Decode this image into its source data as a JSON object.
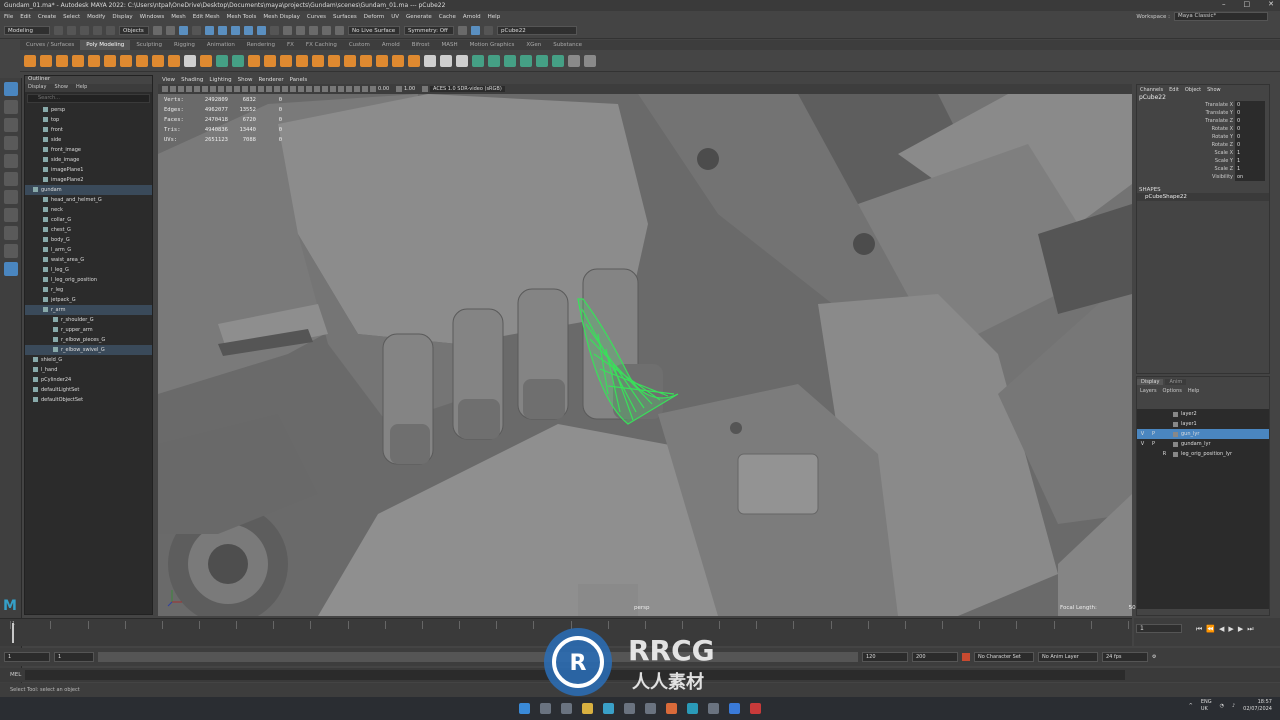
{
  "window": {
    "title": "Gundam_01.ma* - Autodesk MAYA 2022: C:\\Users\\ntpal\\OneDrive\\Desktop\\Documents\\maya\\projects\\Gundam\\scenes\\Gundam_01.ma  ---  pCube22"
  },
  "menubar": {
    "items": [
      "File",
      "Edit",
      "Create",
      "Select",
      "Modify",
      "Display",
      "Windows",
      "Mesh",
      "Edit Mesh",
      "Mesh Tools",
      "Mesh Display",
      "Curves",
      "Surfaces",
      "Deform",
      "UV",
      "Generate",
      "Cache",
      "Arnold",
      "Help"
    ],
    "workspace_label": "Workspace :",
    "workspace_value": "Maya Classic*"
  },
  "statusline": {
    "mode": "Modeling",
    "objects": "Objects",
    "live_surface": "No Live Surface",
    "symmetry": "Symmetry: Off",
    "selection_field": "pCube22"
  },
  "shelf": {
    "tabs": [
      "Curves / Surfaces",
      "Poly Modeling",
      "Sculpting",
      "Rigging",
      "Animation",
      "Rendering",
      "FX",
      "FX Caching",
      "Custom",
      "Arnold",
      "Bifrost",
      "MASH",
      "Motion Graphics",
      "XGen",
      "Substance"
    ],
    "active_tab": "Poly Modeling"
  },
  "outliner": {
    "title": "Outliner",
    "menu": [
      "Display",
      "Show",
      "Help"
    ],
    "search_placeholder": "Search...",
    "rows": [
      {
        "label": "persp",
        "indent": 1,
        "state": ""
      },
      {
        "label": "top",
        "indent": 1,
        "state": ""
      },
      {
        "label": "front",
        "indent": 1,
        "state": ""
      },
      {
        "label": "side",
        "indent": 1,
        "state": ""
      },
      {
        "label": "front_image",
        "indent": 1,
        "state": ""
      },
      {
        "label": "side_image",
        "indent": 1,
        "state": ""
      },
      {
        "label": "imagePlane1",
        "indent": 1,
        "state": ""
      },
      {
        "label": "imagePlane2",
        "indent": 1,
        "state": ""
      },
      {
        "label": "gundam",
        "indent": 0,
        "state": "hl"
      },
      {
        "label": "head_and_helmet_G",
        "indent": 1,
        "state": ""
      },
      {
        "label": "neck",
        "indent": 1,
        "state": ""
      },
      {
        "label": "collar_G",
        "indent": 1,
        "state": ""
      },
      {
        "label": "chest_G",
        "indent": 1,
        "state": ""
      },
      {
        "label": "body_G",
        "indent": 1,
        "state": ""
      },
      {
        "label": "l_arm_G",
        "indent": 1,
        "state": ""
      },
      {
        "label": "waist_area_G",
        "indent": 1,
        "state": ""
      },
      {
        "label": "l_leg_G",
        "indent": 1,
        "state": ""
      },
      {
        "label": "l_leg_orig_position",
        "indent": 1,
        "state": ""
      },
      {
        "label": "r_leg",
        "indent": 1,
        "state": ""
      },
      {
        "label": "jetpack_G",
        "indent": 1,
        "state": ""
      },
      {
        "label": "r_arm",
        "indent": 1,
        "state": "hl"
      },
      {
        "label": "r_shoulder_G",
        "indent": 2,
        "state": ""
      },
      {
        "label": "r_upper_arm",
        "indent": 2,
        "state": ""
      },
      {
        "label": "r_elbow_pieces_G",
        "indent": 2,
        "state": ""
      },
      {
        "label": "r_elbow_swivel_G",
        "indent": 2,
        "state": "hl"
      },
      {
        "label": "shield_G",
        "indent": 0,
        "state": ""
      },
      {
        "label": "l_hand",
        "indent": 0,
        "state": ""
      },
      {
        "label": "pCylinder24",
        "indent": 0,
        "state": ""
      },
      {
        "label": "defaultLightSet",
        "indent": 0,
        "state": ""
      },
      {
        "label": "defaultObjectSet",
        "indent": 0,
        "state": ""
      }
    ]
  },
  "viewport": {
    "menu": [
      "View",
      "Shading",
      "Lighting",
      "Show",
      "Renderer",
      "Panels"
    ],
    "exposure": "0.00",
    "gamma": "1.00",
    "colorspace": "ACES 1.0 SDR-video (sRGB)",
    "camera": "persp",
    "focal_label": "Focal Length:",
    "focal_value": "50",
    "hud": [
      {
        "k": "Verts:",
        "a": "2492809",
        "b": "6832",
        "c": "0"
      },
      {
        "k": "Edges:",
        "a": "4962077",
        "b": "13552",
        "c": "0"
      },
      {
        "k": "Faces:",
        "a": "2470418",
        "b": "6720",
        "c": "0"
      },
      {
        "k": "Tris:",
        "a": "4940836",
        "b": "13440",
        "c": "0"
      },
      {
        "k": "UVs:",
        "a": "2651123",
        "b": "7088",
        "c": "0"
      }
    ]
  },
  "channelbox": {
    "menu": [
      "Channels",
      "Edit",
      "Object",
      "Show"
    ],
    "object": "pCube22",
    "attrs": [
      {
        "n": "Translate X",
        "v": "0"
      },
      {
        "n": "Translate Y",
        "v": "0"
      },
      {
        "n": "Translate Z",
        "v": "0"
      },
      {
        "n": "Rotate X",
        "v": "0"
      },
      {
        "n": "Rotate Y",
        "v": "0"
      },
      {
        "n": "Rotate Z",
        "v": "0"
      },
      {
        "n": "Scale X",
        "v": "1"
      },
      {
        "n": "Scale Y",
        "v": "1"
      },
      {
        "n": "Scale Z",
        "v": "1"
      },
      {
        "n": "Visibility",
        "v": "on"
      }
    ],
    "shapes_header": "SHAPES",
    "shape_name": "pCubeShape22"
  },
  "layers": {
    "tabs": [
      "Display",
      "Anim"
    ],
    "menu": [
      "Layers",
      "Options",
      "Help"
    ],
    "rows": [
      {
        "v": "",
        "p": "",
        "r": "",
        "name": "layer2",
        "sel": false
      },
      {
        "v": "",
        "p": "",
        "r": "",
        "name": "layer1",
        "sel": false
      },
      {
        "v": "V",
        "p": "P",
        "r": "",
        "name": "gun_lyr",
        "sel": true
      },
      {
        "v": "V",
        "p": "P",
        "r": "",
        "name": "gundam_lyr",
        "sel": false
      },
      {
        "v": "",
        "p": "",
        "r": "R",
        "name": "leg_orig_position_lyr",
        "sel": false
      }
    ]
  },
  "timeline": {
    "current_frame": "1",
    "ticks": [
      "1",
      "",
      "",
      "",
      "",
      "",
      "",
      "",
      "",
      "",
      "",
      "",
      "",
      "",
      "",
      "",
      "",
      "",
      "",
      "",
      "",
      "",
      "",
      "",
      "",
      "",
      "",
      "",
      "",
      "",
      ""
    ]
  },
  "range": {
    "start": "1",
    "inner_start": "1",
    "inner_end": "120",
    "end": "200",
    "char_set": "No Character Set",
    "anim_layer": "No Anim Layer",
    "fps": "24 fps"
  },
  "mel": {
    "label": "MEL"
  },
  "helpline": {
    "text": "Select Tool: select an object"
  },
  "tray": {
    "lang": "ENG",
    "region": "UK",
    "time": "18:57",
    "date": "02/07/2024"
  },
  "watermark": {
    "line1": "RRCG",
    "line2": "人人素材"
  },
  "colors": {
    "accent": "#4a86c0",
    "shelf_orange": "#e08a30",
    "shelf_green": "#45a085",
    "wireframe": "#39e05a"
  }
}
